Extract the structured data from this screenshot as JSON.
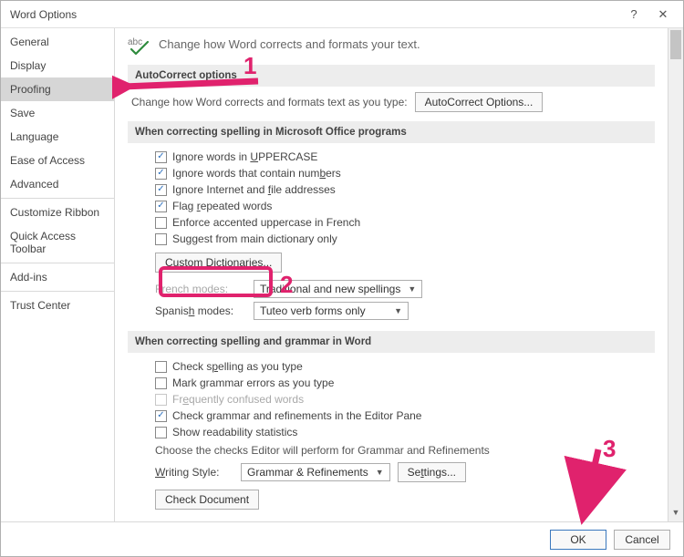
{
  "window": {
    "title": "Word Options",
    "help_icon": "?",
    "close_icon": "✕"
  },
  "sidebar": {
    "items": [
      {
        "label": "General"
      },
      {
        "label": "Display"
      },
      {
        "label": "Proofing"
      },
      {
        "label": "Save"
      },
      {
        "label": "Language"
      },
      {
        "label": "Ease of Access"
      },
      {
        "label": "Advanced"
      },
      {
        "label": "Customize Ribbon"
      },
      {
        "label": "Quick Access Toolbar"
      },
      {
        "label": "Add-ins"
      },
      {
        "label": "Trust Center"
      }
    ],
    "selected": "Proofing"
  },
  "content": {
    "headline": "Change how Word corrects and formats your text.",
    "autocorrect": {
      "section_title": "AutoCorrect options",
      "lead": "Change how Word corrects and formats text as you type:",
      "button": "AutoCorrect Options..."
    },
    "spelling_office": {
      "section_title": "When correcting spelling in Microsoft Office programs",
      "rows": [
        {
          "html": "Ignore words in <span class='ul'>U</span>PPERCASE",
          "checked": true
        },
        {
          "html": "Ignore words that contain num<span class='ul'>b</span>ers",
          "checked": true
        },
        {
          "html": "Ignore Internet and <span class='ul'>f</span>ile addresses",
          "checked": true
        },
        {
          "html": "Flag <span class='ul'>r</span>epeated words",
          "checked": true
        },
        {
          "html": "Enforce accented uppercase in French",
          "checked": false
        },
        {
          "html": "Suggest from main dictionary only",
          "checked": false
        }
      ],
      "custom_dict_btn": "Custom Dictionaries...",
      "french_label_html": "French <span class='ul'>m</span>odes:",
      "french_value": "Traditional and new spellings",
      "spanish_label_html": "Spanis<span class='ul'>h</span> modes:",
      "spanish_value": "Tuteo verb forms only"
    },
    "spelling_word": {
      "section_title": "When correcting spelling and grammar in Word",
      "rows": [
        {
          "html": "Check s<span class='ul'>p</span>elling as you type",
          "checked": false,
          "disabled": false
        },
        {
          "html": "Mark grammar errors as you type",
          "checked": false,
          "disabled": false
        },
        {
          "html": "Fr<span class='ul'>e</span>quently confused words",
          "checked": false,
          "disabled": true
        },
        {
          "html": "Check grammar and refinements in the Editor Pane",
          "checked": true,
          "disabled": false
        },
        {
          "html": "Show readability statistics",
          "checked": false,
          "disabled": false
        }
      ],
      "choose_text": "Choose the checks Editor will perform for Grammar and Refinements",
      "writing_style_label_html": "<span class='ul'>W</span>riting Style:",
      "writing_style_value": "Grammar & Refinements",
      "settings_btn_html": "Se<span class='ul'>t</span>tings...",
      "check_doc_btn": "Check Document"
    }
  },
  "footer": {
    "ok": "OK",
    "cancel": "Cancel"
  },
  "annotations": {
    "n1": "1",
    "n2": "2",
    "n3": "3"
  }
}
